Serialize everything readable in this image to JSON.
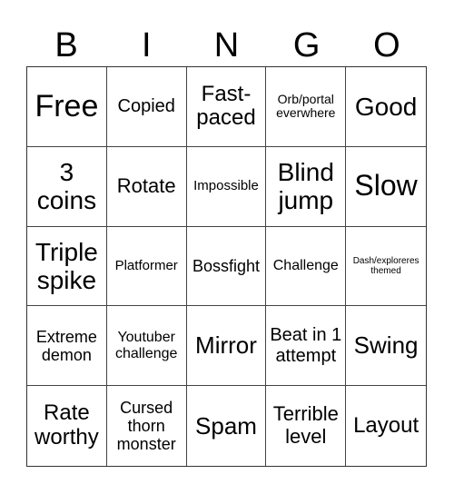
{
  "header": {
    "letters": [
      "B",
      "I",
      "N",
      "G",
      "O"
    ]
  },
  "cells": [
    "Free",
    "Copied",
    "Fast-paced",
    "Orb/portal everwhere",
    "Good",
    "3 coins",
    "Rotate",
    "Impossible",
    "Blind jump",
    "Slow",
    "Triple spike",
    "Platformer",
    "Bossfight",
    "Challenge",
    "Dash/exploreres themed",
    "Extreme demon",
    "Youtuber challenge",
    "Mirror",
    "Beat in 1 attempt",
    "Swing",
    "Rate worthy",
    "Cursed thorn monster",
    "Spam",
    "Terrible level",
    "Layout"
  ]
}
